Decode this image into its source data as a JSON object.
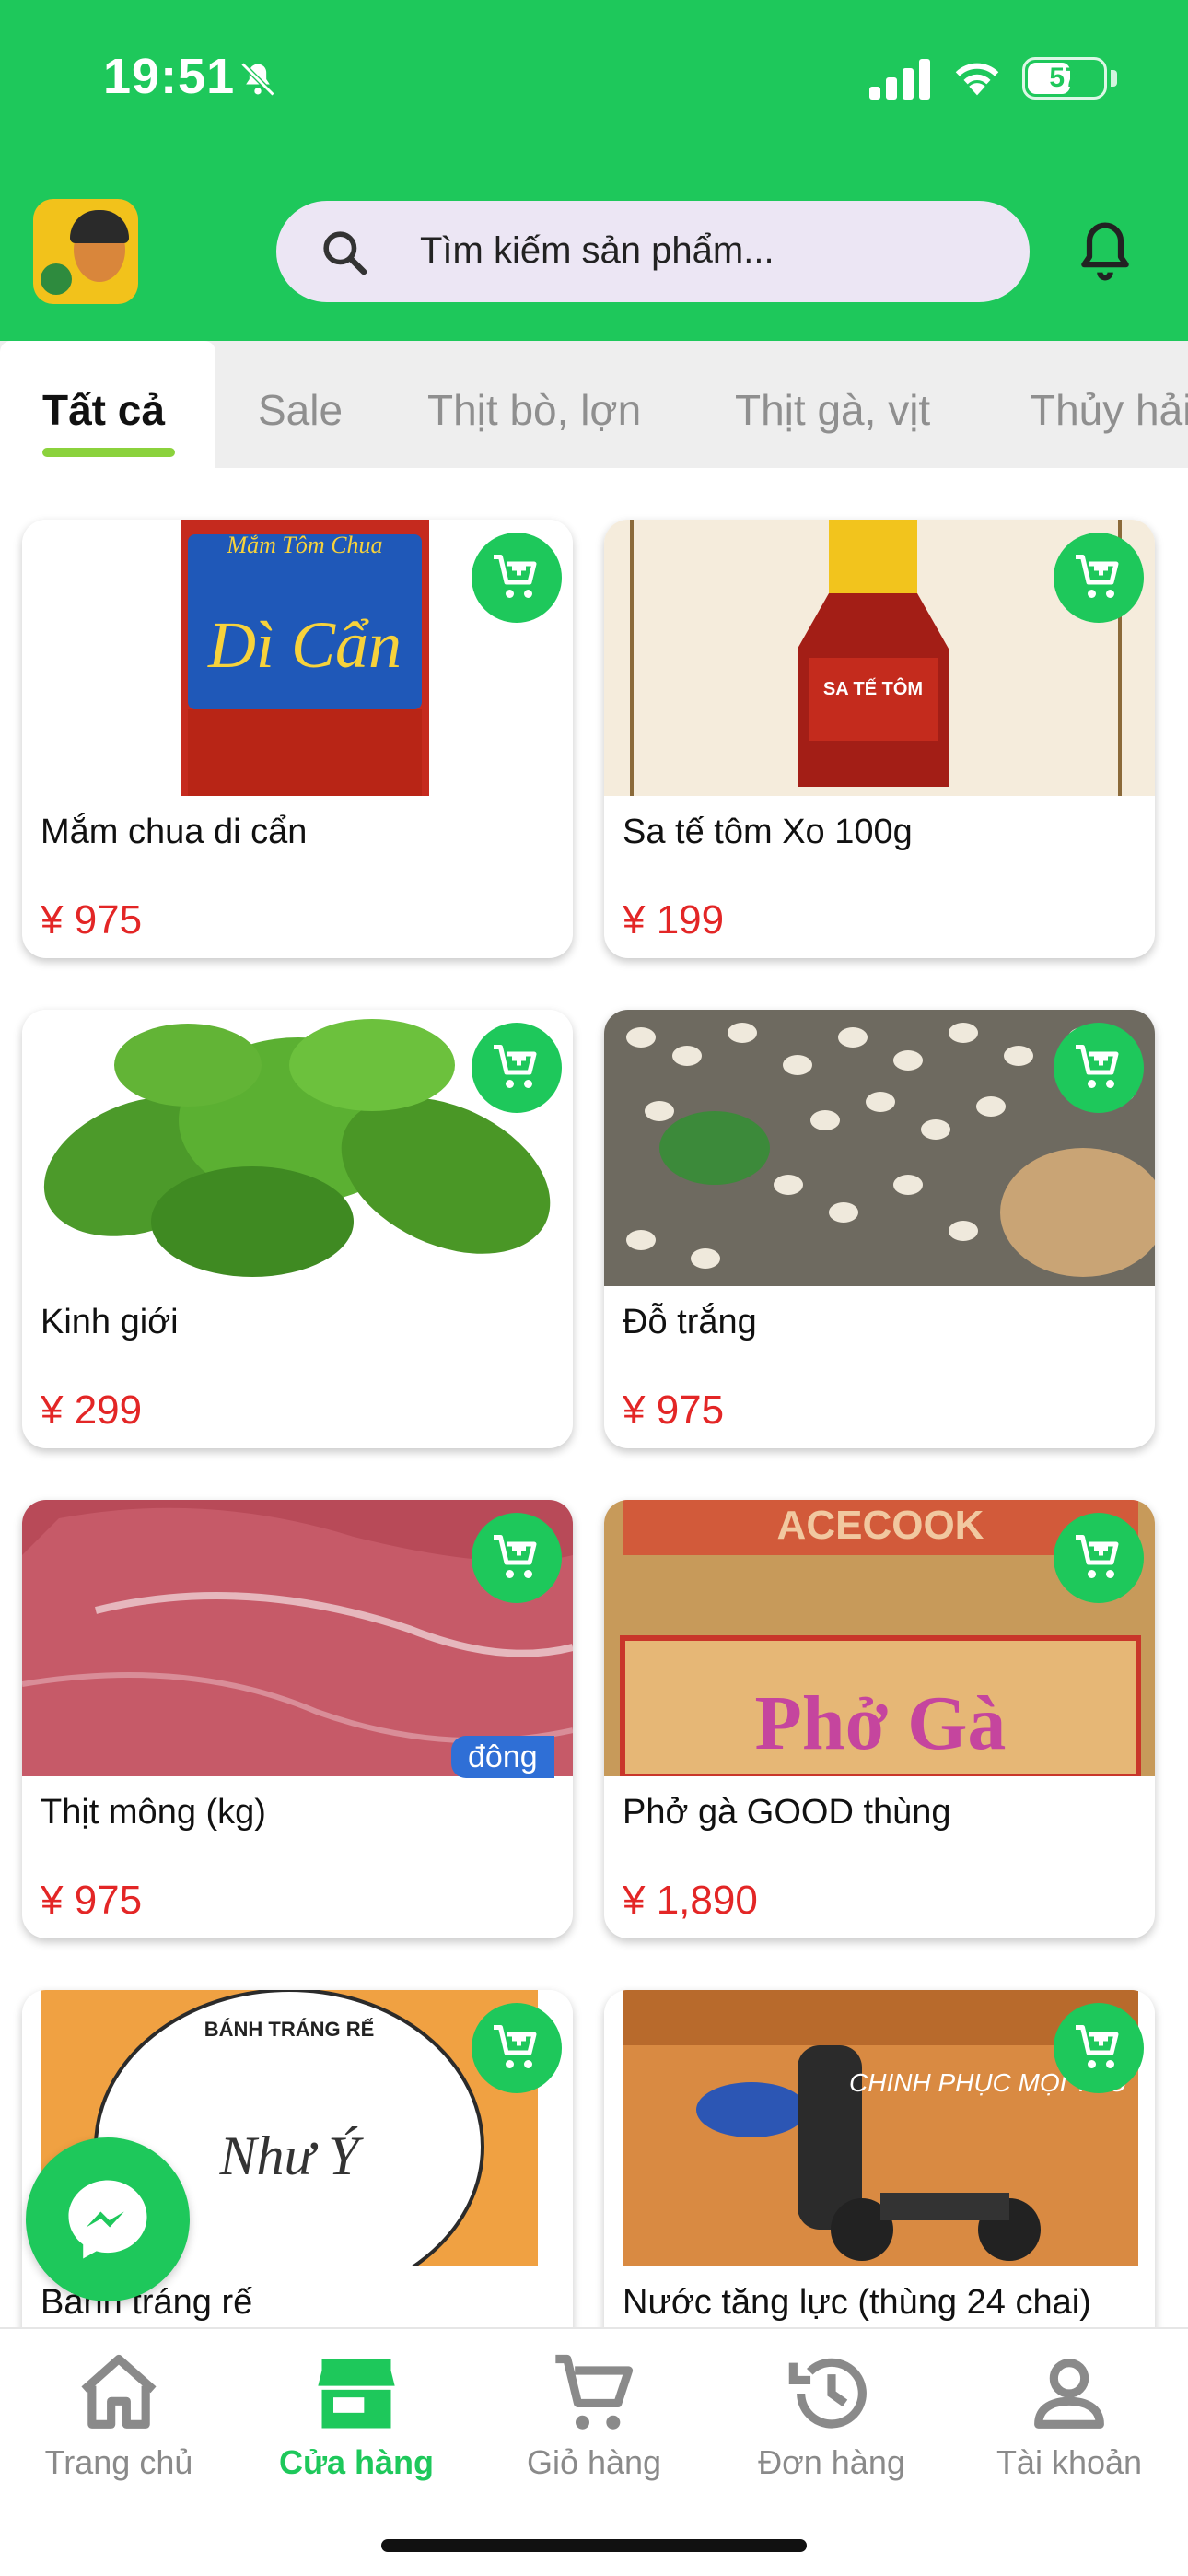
{
  "status_bar": {
    "time": "19:51",
    "battery": "57",
    "battery_level": 0.57
  },
  "search": {
    "placeholder": "Tìm kiếm sản phẩm..."
  },
  "tabs": [
    {
      "label": "Tất cả",
      "active": true
    },
    {
      "label": "Sale"
    },
    {
      "label": "Thịt bò, lợn"
    },
    {
      "label": "Thịt gà, vịt"
    },
    {
      "label": "Thủy hải sản"
    }
  ],
  "products": [
    {
      "name": "Mắm chua di cẩn",
      "price": "¥ 975",
      "image_text": "Mắm Tôm Chua",
      "image_text2": "Dì Cẩn"
    },
    {
      "name": "Sa tế tôm Xo 100g",
      "price": "¥ 199",
      "image_text": "SA TẾ TÔM"
    },
    {
      "name": "Kinh giới",
      "price": "¥ 299"
    },
    {
      "name": "Đỗ trắng",
      "price": "¥ 975"
    },
    {
      "name": "Thịt mông (kg)",
      "price": "¥ 975",
      "badge": "đông"
    },
    {
      "name": "Phở gà GOOD thùng",
      "price": "¥ 1,890",
      "image_text": "ACECOOK",
      "image_text2": "Phở Gà"
    },
    {
      "name": "Bánh tráng rế",
      "price": "",
      "image_text": "BÁNH TRÁNG RẾ",
      "image_text2": "Như Ý"
    },
    {
      "name": "Nước tăng lực (thùng 24 chai)",
      "price": "",
      "image_text": "CHINH PHỤC MỌI THỬ THÁCH"
    }
  ],
  "bottom_nav": [
    {
      "label": "Trang chủ",
      "icon": "home-icon"
    },
    {
      "label": "Cửa hàng",
      "icon": "store-icon",
      "active": true
    },
    {
      "label": "Giỏ hàng",
      "icon": "cart-icon"
    },
    {
      "label": "Đơn hàng",
      "icon": "history-icon"
    },
    {
      "label": "Tài khoản",
      "icon": "account-icon"
    }
  ],
  "colors": {
    "primary": "#1ec85b",
    "price": "#e32626",
    "frozen_badge": "#2f6fd6"
  }
}
